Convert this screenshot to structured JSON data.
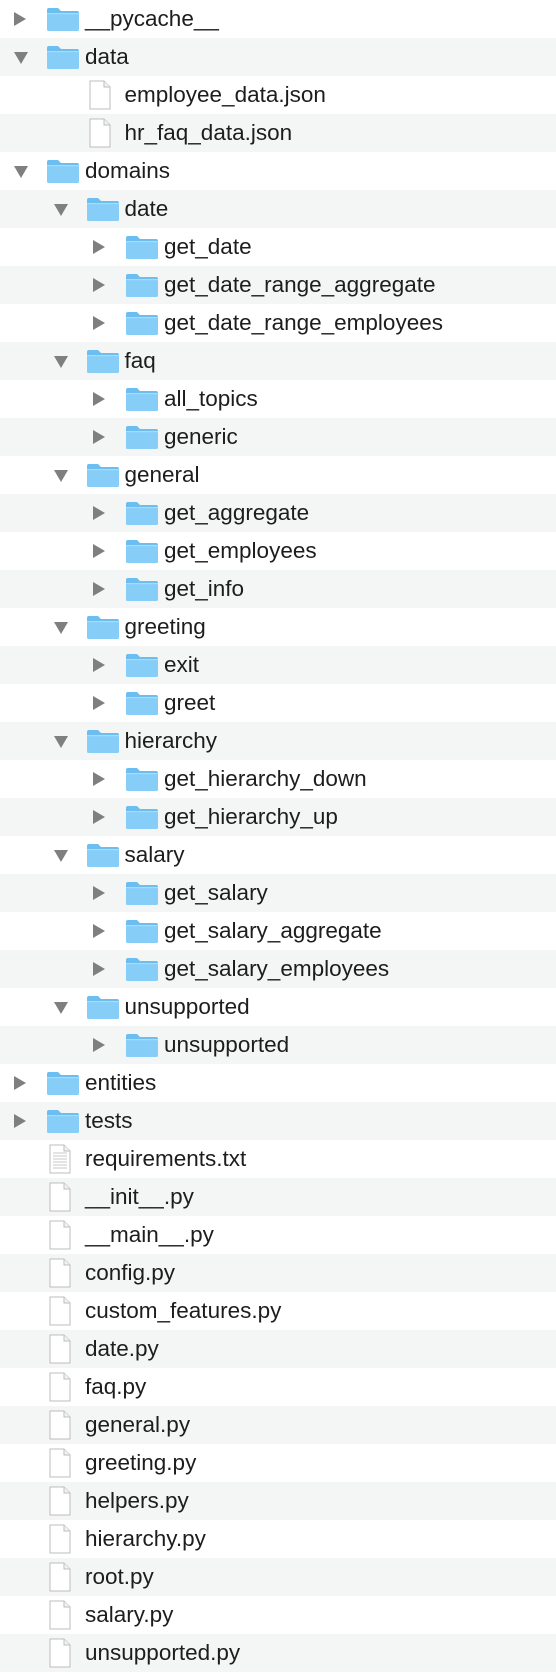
{
  "colors": {
    "folder_front": "#86cdf8",
    "folder_back": "#6cbdf0",
    "row_alt": "#f4f5f5",
    "disclosure": "#7f7f7f",
    "text": "#1d1d1d"
  },
  "tree": [
    {
      "label": "__pycache__",
      "kind": "folder",
      "depth": 0,
      "expanded": false
    },
    {
      "label": "data",
      "kind": "folder",
      "depth": 0,
      "expanded": true
    },
    {
      "label": "employee_data.json",
      "kind": "file",
      "depth": 1
    },
    {
      "label": "hr_faq_data.json",
      "kind": "file",
      "depth": 1
    },
    {
      "label": "domains",
      "kind": "folder",
      "depth": 0,
      "expanded": true
    },
    {
      "label": "date",
      "kind": "folder",
      "depth": 1,
      "expanded": true
    },
    {
      "label": "get_date",
      "kind": "folder",
      "depth": 2,
      "expanded": false
    },
    {
      "label": "get_date_range_aggregate",
      "kind": "folder",
      "depth": 2,
      "expanded": false
    },
    {
      "label": "get_date_range_employees",
      "kind": "folder",
      "depth": 2,
      "expanded": false
    },
    {
      "label": "faq",
      "kind": "folder",
      "depth": 1,
      "expanded": true
    },
    {
      "label": "all_topics",
      "kind": "folder",
      "depth": 2,
      "expanded": false
    },
    {
      "label": "generic",
      "kind": "folder",
      "depth": 2,
      "expanded": false
    },
    {
      "label": "general",
      "kind": "folder",
      "depth": 1,
      "expanded": true
    },
    {
      "label": "get_aggregate",
      "kind": "folder",
      "depth": 2,
      "expanded": false
    },
    {
      "label": "get_employees",
      "kind": "folder",
      "depth": 2,
      "expanded": false
    },
    {
      "label": "get_info",
      "kind": "folder",
      "depth": 2,
      "expanded": false
    },
    {
      "label": "greeting",
      "kind": "folder",
      "depth": 1,
      "expanded": true
    },
    {
      "label": "exit",
      "kind": "folder",
      "depth": 2,
      "expanded": false
    },
    {
      "label": "greet",
      "kind": "folder",
      "depth": 2,
      "expanded": false
    },
    {
      "label": "hierarchy",
      "kind": "folder",
      "depth": 1,
      "expanded": true
    },
    {
      "label": "get_hierarchy_down",
      "kind": "folder",
      "depth": 2,
      "expanded": false
    },
    {
      "label": "get_hierarchy_up",
      "kind": "folder",
      "depth": 2,
      "expanded": false
    },
    {
      "label": "salary",
      "kind": "folder",
      "depth": 1,
      "expanded": true
    },
    {
      "label": "get_salary",
      "kind": "folder",
      "depth": 2,
      "expanded": false
    },
    {
      "label": "get_salary_aggregate",
      "kind": "folder",
      "depth": 2,
      "expanded": false
    },
    {
      "label": "get_salary_employees",
      "kind": "folder",
      "depth": 2,
      "expanded": false
    },
    {
      "label": "unsupported",
      "kind": "folder",
      "depth": 1,
      "expanded": true
    },
    {
      "label": "unsupported",
      "kind": "folder",
      "depth": 2,
      "expanded": false
    },
    {
      "label": "entities",
      "kind": "folder",
      "depth": 0,
      "expanded": false
    },
    {
      "label": "tests",
      "kind": "folder",
      "depth": 0,
      "expanded": false
    },
    {
      "label": "requirements.txt",
      "kind": "textfile",
      "depth": 0
    },
    {
      "label": "__init__.py",
      "kind": "file",
      "depth": 0
    },
    {
      "label": "__main__.py",
      "kind": "file",
      "depth": 0
    },
    {
      "label": "config.py",
      "kind": "file",
      "depth": 0
    },
    {
      "label": "custom_features.py",
      "kind": "file",
      "depth": 0
    },
    {
      "label": "date.py",
      "kind": "file",
      "depth": 0
    },
    {
      "label": "faq.py",
      "kind": "file",
      "depth": 0
    },
    {
      "label": "general.py",
      "kind": "file",
      "depth": 0
    },
    {
      "label": "greeting.py",
      "kind": "file",
      "depth": 0
    },
    {
      "label": "helpers.py",
      "kind": "file",
      "depth": 0
    },
    {
      "label": "hierarchy.py",
      "kind": "file",
      "depth": 0
    },
    {
      "label": "root.py",
      "kind": "file",
      "depth": 0
    },
    {
      "label": "salary.py",
      "kind": "file",
      "depth": 0
    },
    {
      "label": "unsupported.py",
      "kind": "file",
      "depth": 0
    }
  ]
}
